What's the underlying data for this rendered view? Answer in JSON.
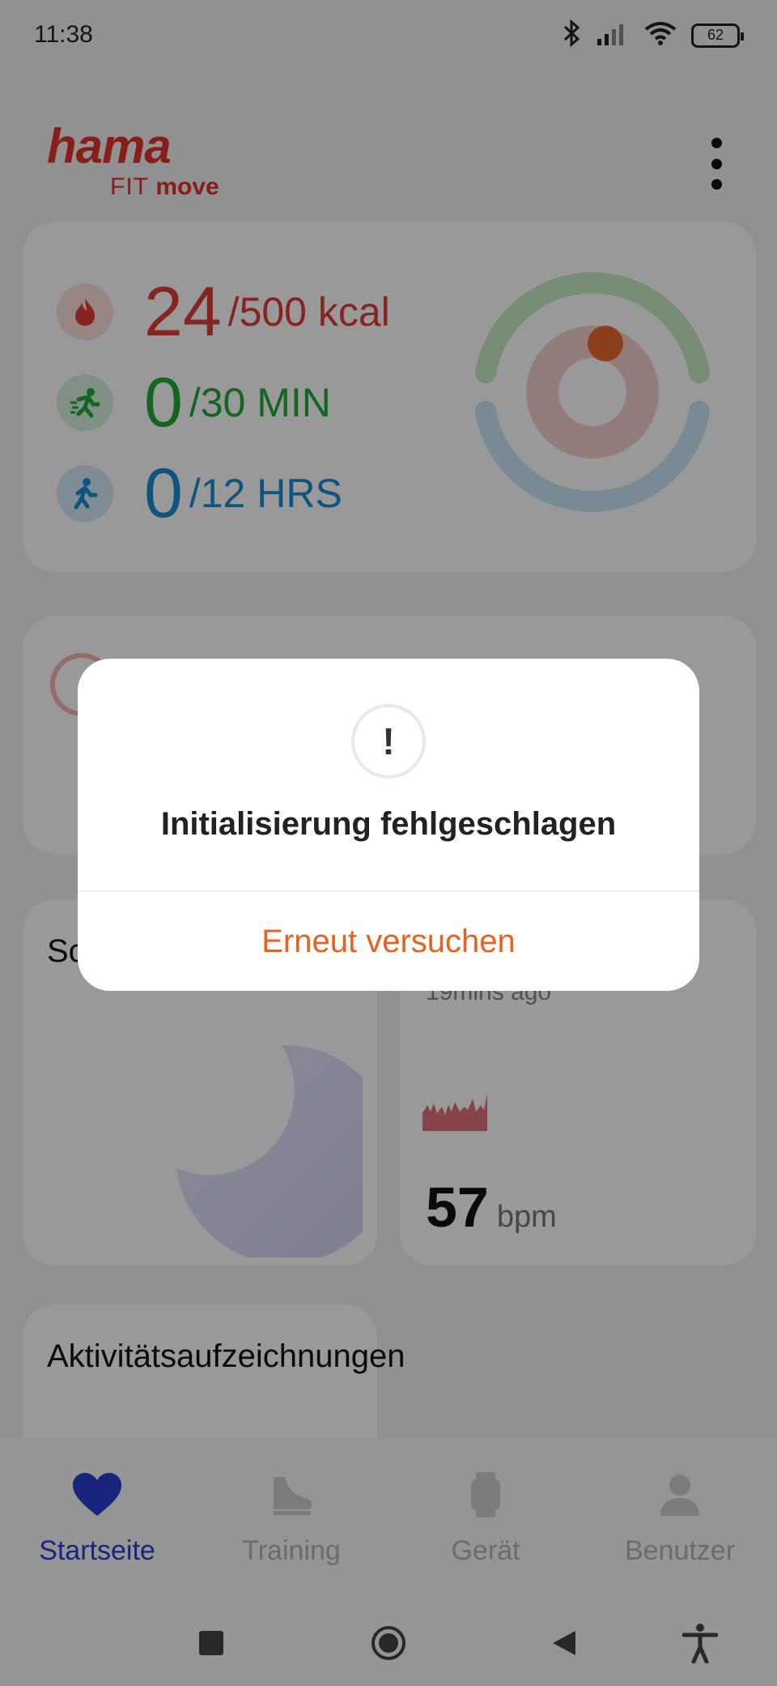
{
  "status_bar": {
    "time": "11:38",
    "battery": "62",
    "icons": [
      "bluetooth-icon",
      "signal-icon",
      "wifi-icon",
      "battery-icon"
    ]
  },
  "header": {
    "logo_main": "hama",
    "logo_sub_fit": "FIT",
    "logo_sub_move": "move",
    "menu_icon": "more-vertical-icon"
  },
  "activity": {
    "calories": {
      "value": "24",
      "goal": "/500 kcal",
      "icon": "flame-icon",
      "color": "#e23b36"
    },
    "exercise": {
      "value": "0",
      "goal": "/30 MIN",
      "icon": "running-icon",
      "color": "#1faa3a"
    },
    "standing": {
      "value": "0",
      "goal": "/12 HRS",
      "icon": "walking-icon",
      "color": "#1a8ad4"
    }
  },
  "sleep": {
    "title_partial": "Sc"
  },
  "heart_rate": {
    "ago": "19mins ago",
    "value": "57",
    "unit": "bpm"
  },
  "activity_log": {
    "title": "Aktivitätsaufzeichnungen"
  },
  "bottom_nav": {
    "items": [
      {
        "label": "Startseite",
        "icon": "heart-icon",
        "active": true
      },
      {
        "label": "Training",
        "icon": "shoe-icon",
        "active": false
      },
      {
        "label": "Gerät",
        "icon": "watch-icon",
        "active": false
      },
      {
        "label": "Benutzer",
        "icon": "user-icon",
        "active": false
      }
    ]
  },
  "dialog": {
    "icon": "!",
    "title": "Initialisierung fehlgeschlagen",
    "action": "Erneut versuchen",
    "action_color": "#e8621d"
  },
  "system_nav": [
    "recents-icon",
    "home-icon",
    "back-icon",
    "accessibility-icon"
  ]
}
